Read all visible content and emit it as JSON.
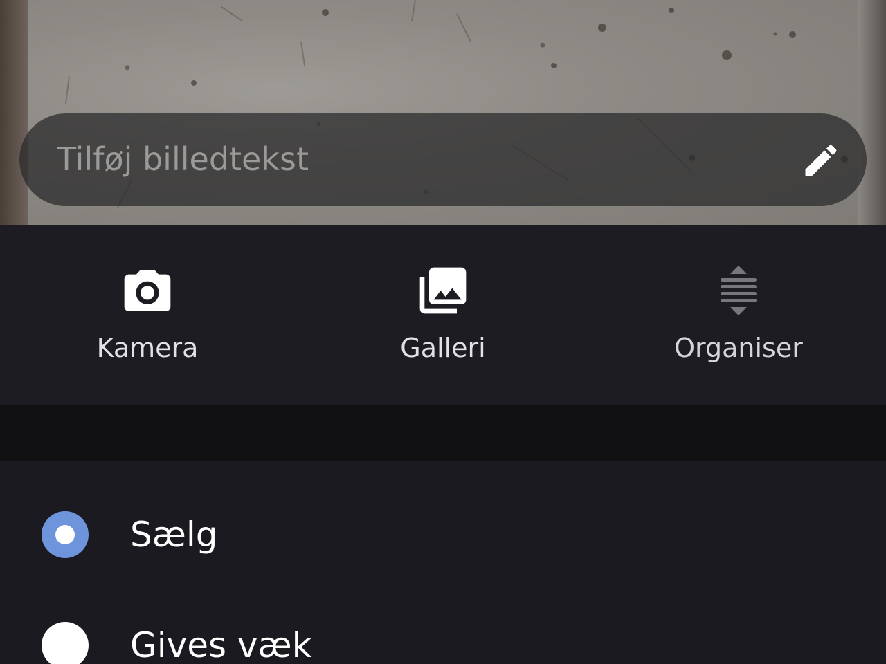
{
  "caption": {
    "placeholder": "Tilføj billedtekst",
    "edit_icon": "pencil-icon"
  },
  "toolbar": {
    "items": [
      {
        "label": "Kamera",
        "icon": "camera-icon"
      },
      {
        "label": "Galleri",
        "icon": "gallery-icon"
      },
      {
        "label": "Organiser",
        "icon": "reorder-icon"
      }
    ]
  },
  "listing_type": {
    "options": [
      {
        "label": "Sælg",
        "selected": true
      },
      {
        "label": "Gives væk",
        "selected": false
      }
    ]
  },
  "colors": {
    "accent": "#6e95dc",
    "panel_background": "#1c1c22",
    "divider_band": "#111114"
  }
}
